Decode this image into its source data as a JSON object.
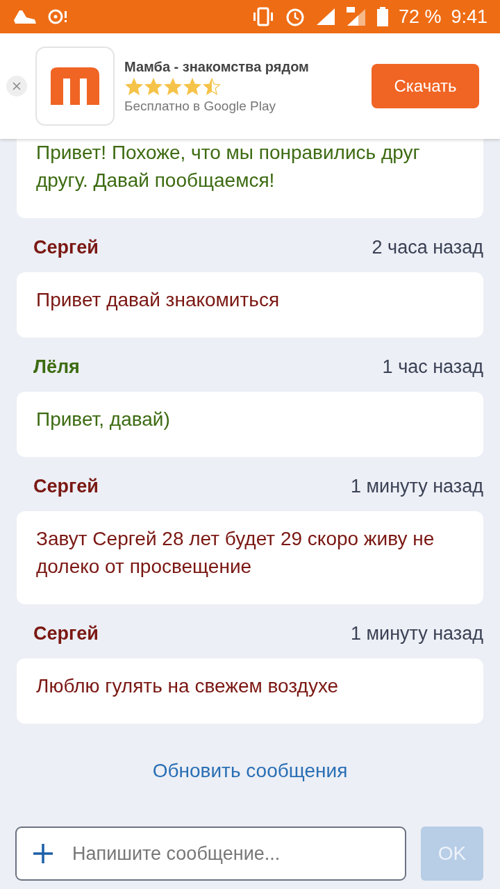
{
  "status_bar": {
    "battery": "72 %",
    "time": "9:41"
  },
  "ad": {
    "title": "Мамба - знакомства рядом",
    "stars": 4.5,
    "subtitle": "Бесплатно в Google Play",
    "button": "Скачать"
  },
  "messages": [
    {
      "text": "Привет! Похоже, что мы понравились друг другу. Давай пообщаемся!",
      "color": "#3d6b12"
    },
    {
      "sender": "Сергей",
      "time": "2 часа назад",
      "text": "Привет давай знакомиться",
      "color": "#7a1712"
    },
    {
      "sender": "Лёля",
      "time": "1 час назад",
      "text": "Привет, давай)",
      "color": "#3d6b12"
    },
    {
      "sender": "Сергей",
      "time": "1 минуту назад",
      "text": "Завут Сергей 28 лет будет 29 скоро живу не долеко от просвещение",
      "color": "#7a1712"
    },
    {
      "sender": "Сергей",
      "time": "1 минуту назад",
      "text": "Люблю гулять на свежем воздухе",
      "color": "#7a1712"
    }
  ],
  "refresh_link": "Обновить сообщения",
  "composer": {
    "placeholder": "Напишите сообщение...",
    "send_button": {
      "label": "OK",
      "disabled": true
    }
  }
}
